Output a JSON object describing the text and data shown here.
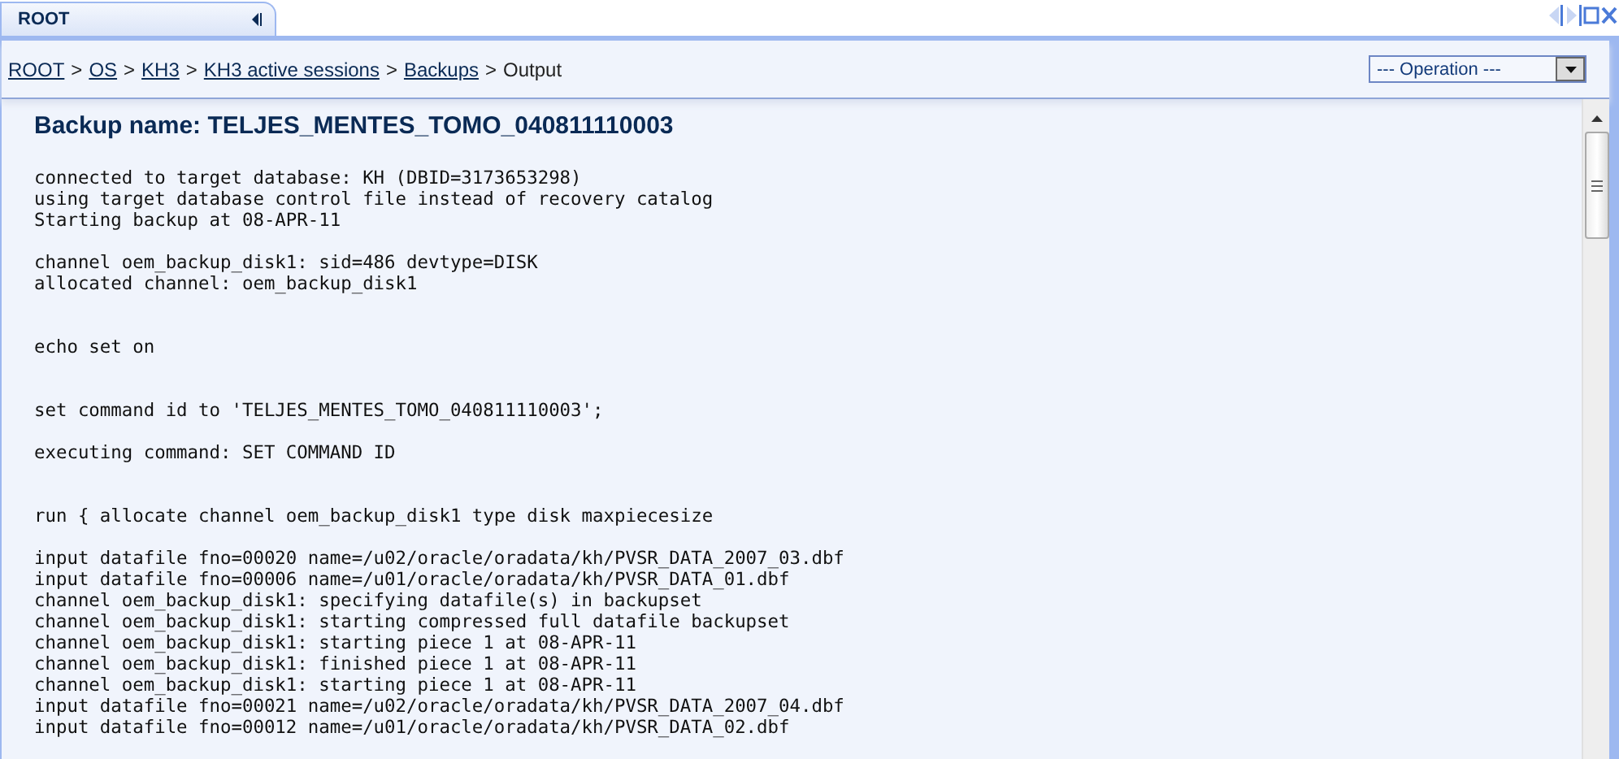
{
  "tab": {
    "label": "ROOT",
    "selected": true
  },
  "breadcrumb": [
    {
      "label": "ROOT",
      "kind": "link"
    },
    {
      "label": ">",
      "kind": "separator"
    },
    {
      "label": "OS",
      "kind": "link"
    },
    {
      "label": ">",
      "kind": "separator"
    },
    {
      "label": "KH3",
      "kind": "link"
    },
    {
      "label": ">",
      "kind": "separator"
    },
    {
      "label": "KH3 active sessions",
      "kind": "link"
    },
    {
      "label": ">",
      "kind": "separator"
    },
    {
      "label": "Backups",
      "kind": "link"
    },
    {
      "label": ">",
      "kind": "separator"
    },
    {
      "label": "Output",
      "kind": "current"
    }
  ],
  "operation_select": {
    "value": "--- Operation ---"
  },
  "heading": "Backup name: TELJES_MENTES_TOMO_040811110003",
  "output": "connected to target database: KH (DBID=3173653298)\nusing target database control file instead of recovery catalog\nStarting backup at 08-APR-11\n\nchannel oem_backup_disk1: sid=486 devtype=DISK\nallocated channel: oem_backup_disk1\n\n\necho set on\n\n\nset command id to 'TELJES_MENTES_TOMO_040811110003';\n\nexecuting command: SET COMMAND ID\n\n\nrun { allocate channel oem_backup_disk1 type disk maxpiecesize\n\ninput datafile fno=00020 name=/u02/oracle/oradata/kh/PVSR_DATA_2007_03.dbf\ninput datafile fno=00006 name=/u01/oracle/oradata/kh/PVSR_DATA_01.dbf\nchannel oem_backup_disk1: specifying datafile(s) in backupset\nchannel oem_backup_disk1: starting compressed full datafile backupset\nchannel oem_backup_disk1: starting piece 1 at 08-APR-11\nchannel oem_backup_disk1: finished piece 1 at 08-APR-11\nchannel oem_backup_disk1: starting piece 1 at 08-APR-11\ninput datafile fno=00021 name=/u02/oracle/oradata/kh/PVSR_DATA_2007_04.dbf\ninput datafile fno=00012 name=/u01/oracle/oradata/kh/PVSR_DATA_02.dbf"
}
